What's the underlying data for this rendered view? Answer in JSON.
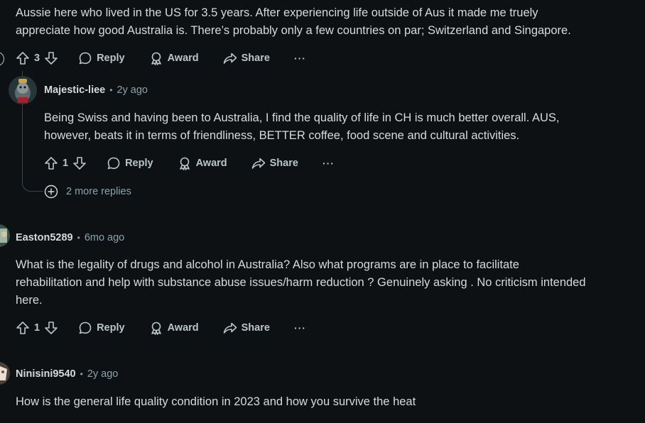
{
  "comments": [
    {
      "body": "Aussie here who lived in the US for 3.5 years. After experiencing life outside of Aus it made me truely appreciate how good Australia is. There’s probably only a few countries on par; Switzerland and Singapore.",
      "body_lines": [
        "Aussie here who lived in the US for 3.5 years. After experiencing life outside of Aus it made me truely",
        "appreciate how good Australia is. There’s probably only a few countries on par; Switzerland and Singapore."
      ],
      "votes": "3"
    },
    {
      "author": "Majestic-liee",
      "time": "2y ago",
      "body_lines": [
        "Being Swiss and having been to Australia, I find the quality of life in CH is much better overall. AUS,",
        "however, beats it in terms of friendliness, BETTER coffee, food scene and cultural activities."
      ],
      "votes": "1",
      "more_replies": "2 more replies"
    },
    {
      "author": "Easton5289",
      "time": "6mo ago",
      "body_lines": [
        "What is the legality of drugs and alcohol in Australia? Also what programs are in place to facilitate",
        "rehabilitation and help with substance abuse issues/harm reduction ? Genuinely asking . No criticism intended",
        "here."
      ],
      "votes": "1"
    },
    {
      "author": "Ninisini9540",
      "time": "2y ago",
      "body_lines": [
        "How is the general life quality condition in 2023 and how you survive the heat"
      ]
    }
  ],
  "actions": {
    "reply": "Reply",
    "award": "Award",
    "share": "Share",
    "more": "···",
    "separator": "•"
  },
  "icons": [
    "upvote-icon",
    "downvote-icon",
    "reply-icon",
    "award-icon",
    "share-icon",
    "overflow-icon",
    "expand-icon"
  ],
  "colors": {
    "background": "#0e1113",
    "text": "#d7dadc",
    "muted": "#8ba2ad",
    "thread_line": "#33464c"
  }
}
